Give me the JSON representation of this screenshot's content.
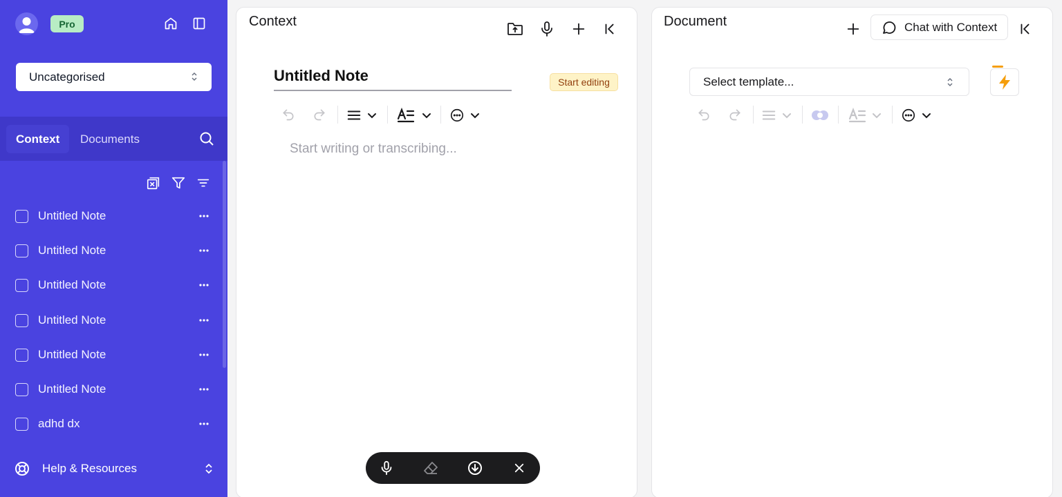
{
  "sidebar": {
    "badge": "Pro",
    "category": "Uncategorised",
    "tabs": [
      {
        "label": "Context"
      },
      {
        "label": "Documents"
      }
    ],
    "notes": [
      {
        "label": "Untitled Note"
      },
      {
        "label": "Untitled Note"
      },
      {
        "label": "Untitled Note"
      },
      {
        "label": "Untitled Note"
      },
      {
        "label": "Untitled Note"
      },
      {
        "label": "Untitled Note"
      },
      {
        "label": "adhd dx"
      }
    ],
    "help": "Help & Resources"
  },
  "context_panel": {
    "title": "Context",
    "note_title": "Untitled Note",
    "start_editing": "Start editing",
    "placeholder": "Start writing or transcribing..."
  },
  "document_panel": {
    "title": "Document",
    "chat_button": "Chat with Context",
    "template_placeholder": "Select template..."
  },
  "colors": {
    "sidebar_bg": "#4a43e0",
    "tab_bar_bg": "#3f38c9",
    "pro_badge": "#b8ecc4",
    "start_editing_bg": "#fef3c7",
    "bolt": "#f59e0b",
    "recorder_bg": "#1c1c1e"
  },
  "icons": {
    "sidebar": [
      "user-avatar-icon",
      "home-icon",
      "sidebar-toggle-icon",
      "chevron-up-down-icon",
      "search-icon",
      "clear-filter-icon",
      "filter-icon",
      "sort-icon",
      "more-horizontal-icon",
      "lifebuoy-icon"
    ],
    "context": [
      "upload-folder-icon",
      "microphone-icon",
      "plus-icon",
      "collapse-left-icon",
      "undo-icon",
      "redo-icon",
      "align-icon",
      "text-style-icon",
      "emoji-icon"
    ],
    "document": [
      "plus-icon",
      "chat-icon",
      "collapse-left-icon",
      "bolt-icon",
      "link-icon"
    ],
    "recorder": [
      "microphone-icon",
      "eraser-icon",
      "download-icon",
      "close-icon"
    ]
  }
}
